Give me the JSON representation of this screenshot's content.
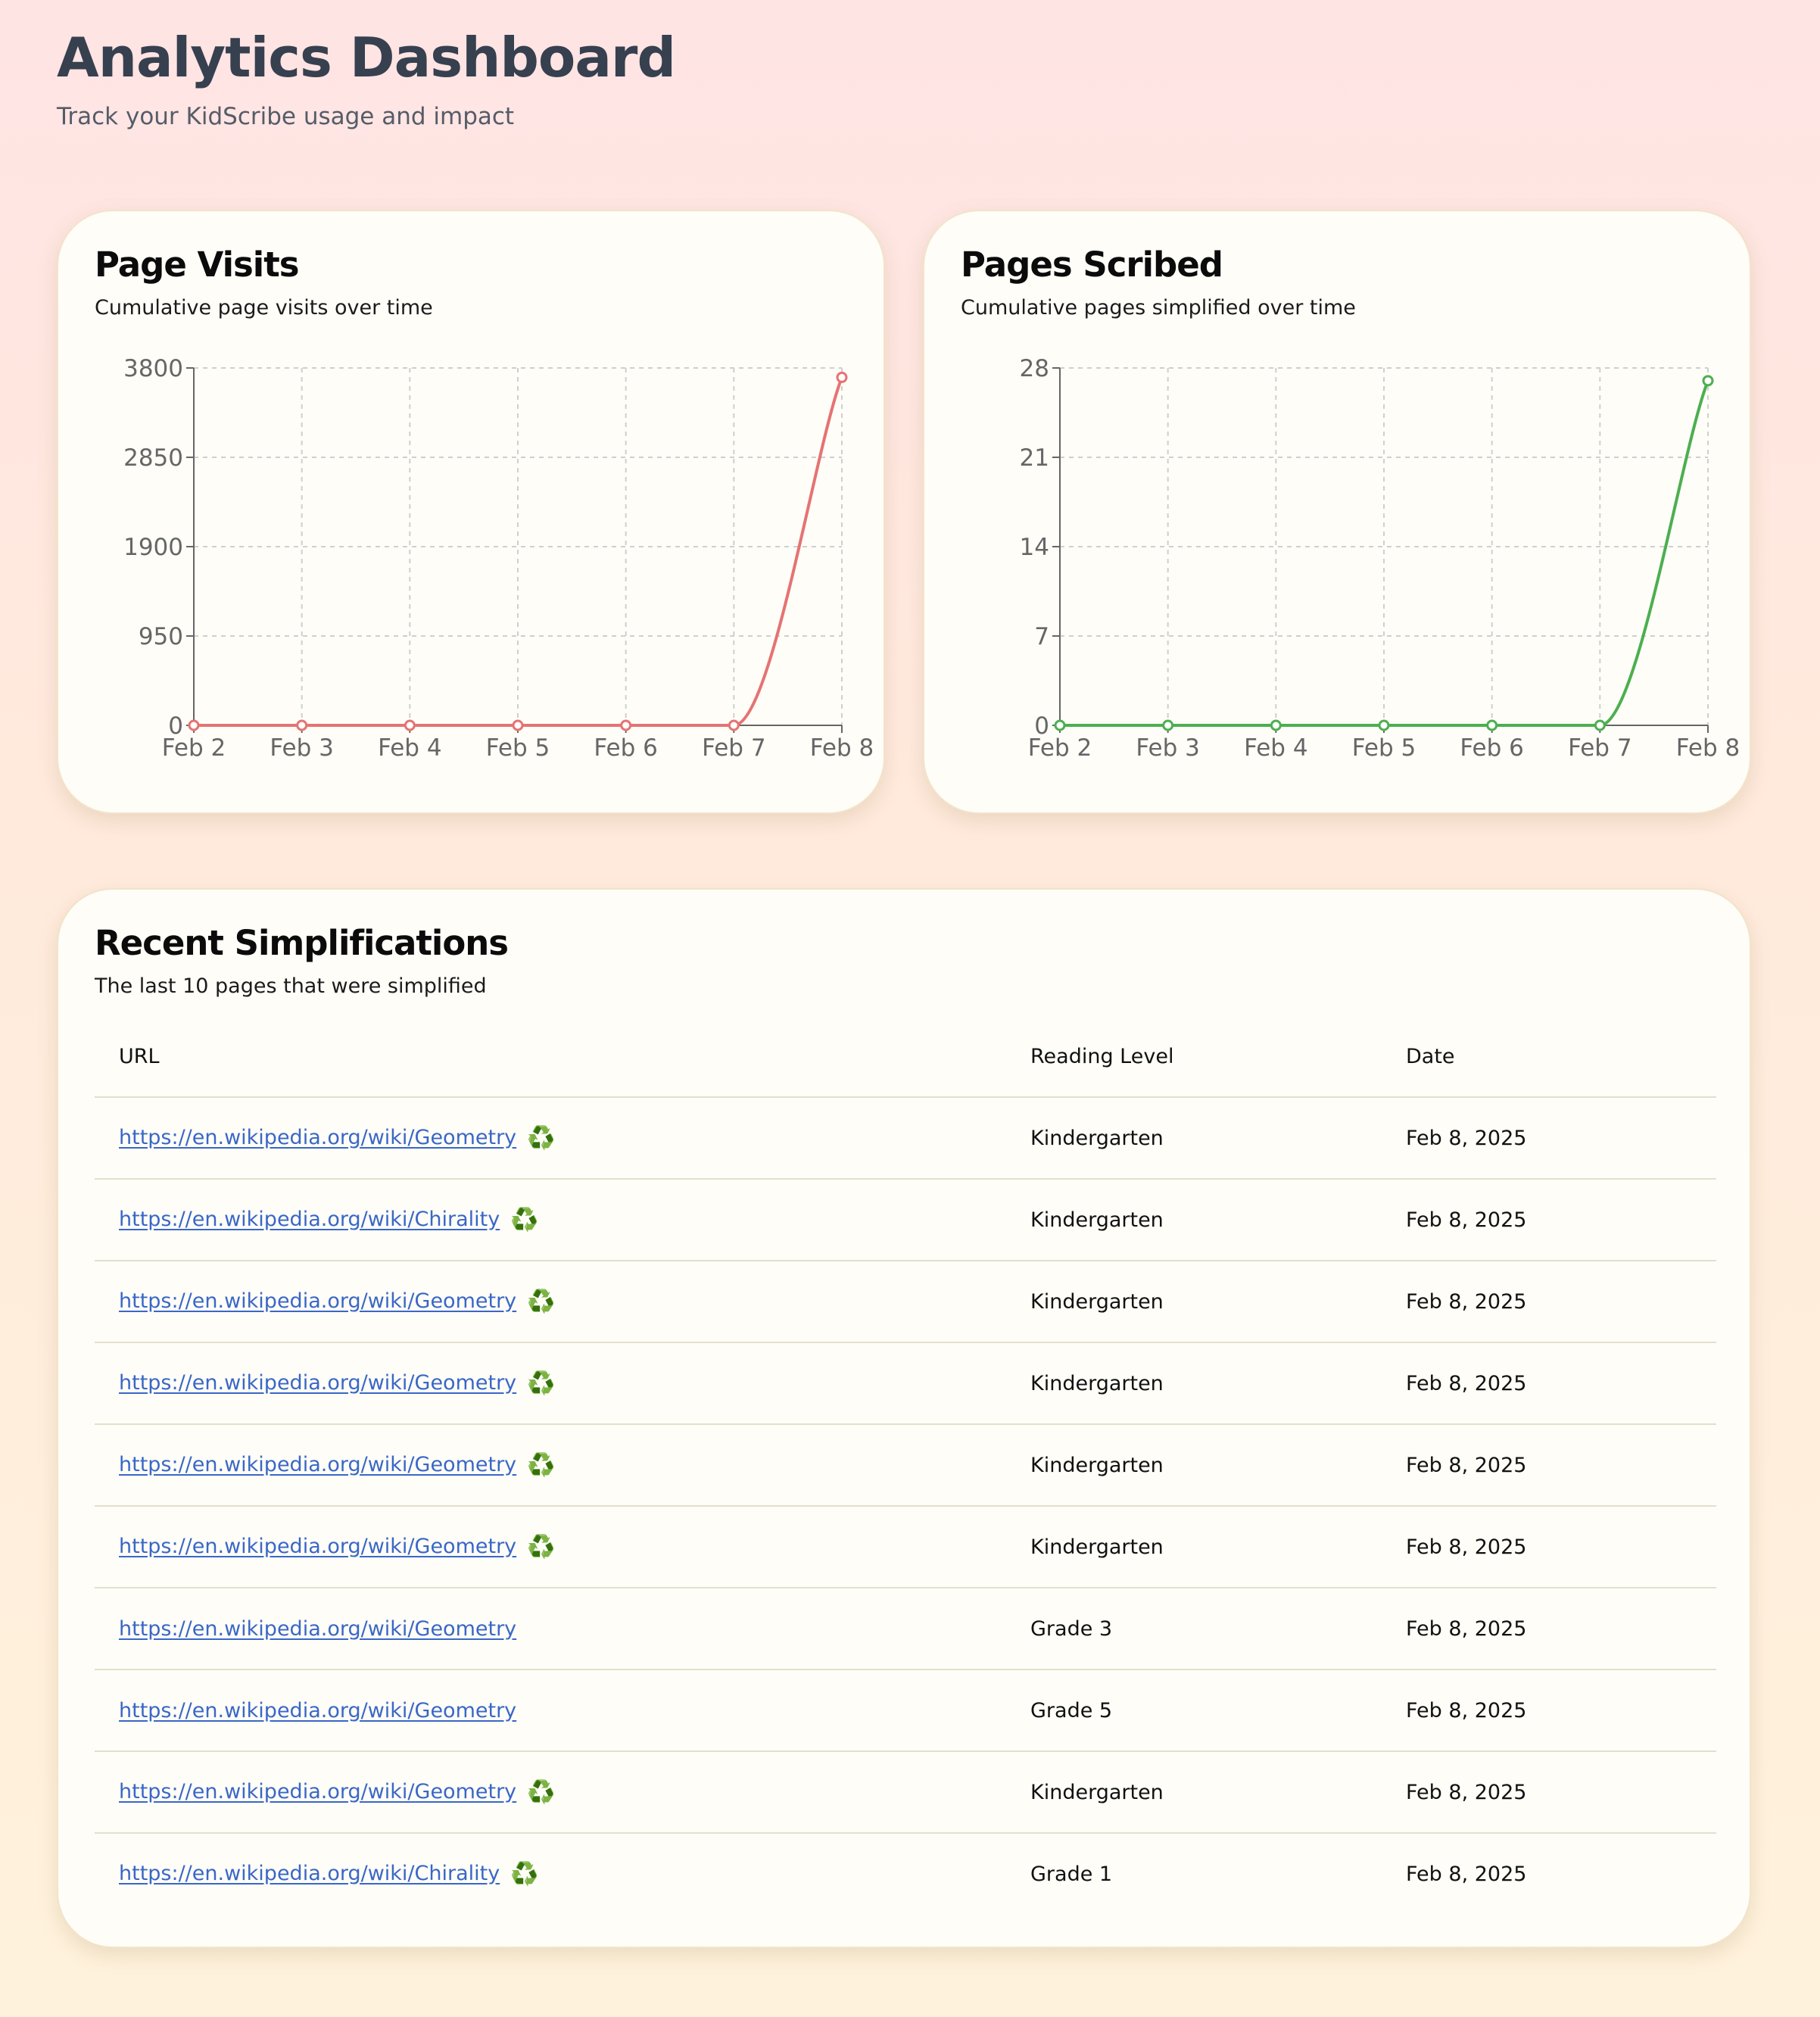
{
  "header": {
    "title": "Analytics Dashboard",
    "subtitle": "Track your KidScribe usage and impact"
  },
  "visits_card": {
    "title": "Page Visits",
    "description": "Cumulative page visits over time"
  },
  "scribed_card": {
    "title": "Pages Scribed",
    "description": "Cumulative pages simplified over time"
  },
  "chart_data": [
    {
      "type": "line",
      "title": "Page Visits",
      "categories": [
        "Feb 2",
        "Feb 3",
        "Feb 4",
        "Feb 5",
        "Feb 6",
        "Feb 7",
        "Feb 8"
      ],
      "values": [
        0,
        0,
        0,
        0,
        0,
        0,
        3700
      ],
      "yticks": [
        0,
        950,
        1900,
        2850,
        3800
      ],
      "ylim": [
        0,
        3800
      ],
      "grid": true,
      "color": "#e57373"
    },
    {
      "type": "line",
      "title": "Pages Scribed",
      "categories": [
        "Feb 2",
        "Feb 3",
        "Feb 4",
        "Feb 5",
        "Feb 6",
        "Feb 7",
        "Feb 8"
      ],
      "values": [
        0,
        0,
        0,
        0,
        0,
        0,
        27
      ],
      "yticks": [
        0,
        7,
        14,
        21,
        28
      ],
      "ylim": [
        0,
        28
      ],
      "grid": true,
      "color": "#4caf50"
    }
  ],
  "recent": {
    "title": "Recent Simplifications",
    "description": "The last 10 pages that were simplified",
    "columns": [
      "URL",
      "Reading Level",
      "Date"
    ],
    "recycle_icon": "♻️",
    "rows": [
      {
        "url": "https://en.wikipedia.org/wiki/Geometry",
        "recycled": true,
        "level": "Kindergarten",
        "date": "Feb 8, 2025"
      },
      {
        "url": "https://en.wikipedia.org/wiki/Chirality",
        "recycled": true,
        "level": "Kindergarten",
        "date": "Feb 8, 2025"
      },
      {
        "url": "https://en.wikipedia.org/wiki/Geometry",
        "recycled": true,
        "level": "Kindergarten",
        "date": "Feb 8, 2025"
      },
      {
        "url": "https://en.wikipedia.org/wiki/Geometry",
        "recycled": true,
        "level": "Kindergarten",
        "date": "Feb 8, 2025"
      },
      {
        "url": "https://en.wikipedia.org/wiki/Geometry",
        "recycled": true,
        "level": "Kindergarten",
        "date": "Feb 8, 2025"
      },
      {
        "url": "https://en.wikipedia.org/wiki/Geometry",
        "recycled": true,
        "level": "Kindergarten",
        "date": "Feb 8, 2025"
      },
      {
        "url": "https://en.wikipedia.org/wiki/Geometry",
        "recycled": false,
        "level": "Grade 3",
        "date": "Feb 8, 2025"
      },
      {
        "url": "https://en.wikipedia.org/wiki/Geometry",
        "recycled": false,
        "level": "Grade 5",
        "date": "Feb 8, 2025"
      },
      {
        "url": "https://en.wikipedia.org/wiki/Geometry",
        "recycled": true,
        "level": "Kindergarten",
        "date": "Feb 8, 2025"
      },
      {
        "url": "https://en.wikipedia.org/wiki/Chirality",
        "recycled": true,
        "level": "Grade 1",
        "date": "Feb 8, 2025"
      }
    ]
  }
}
